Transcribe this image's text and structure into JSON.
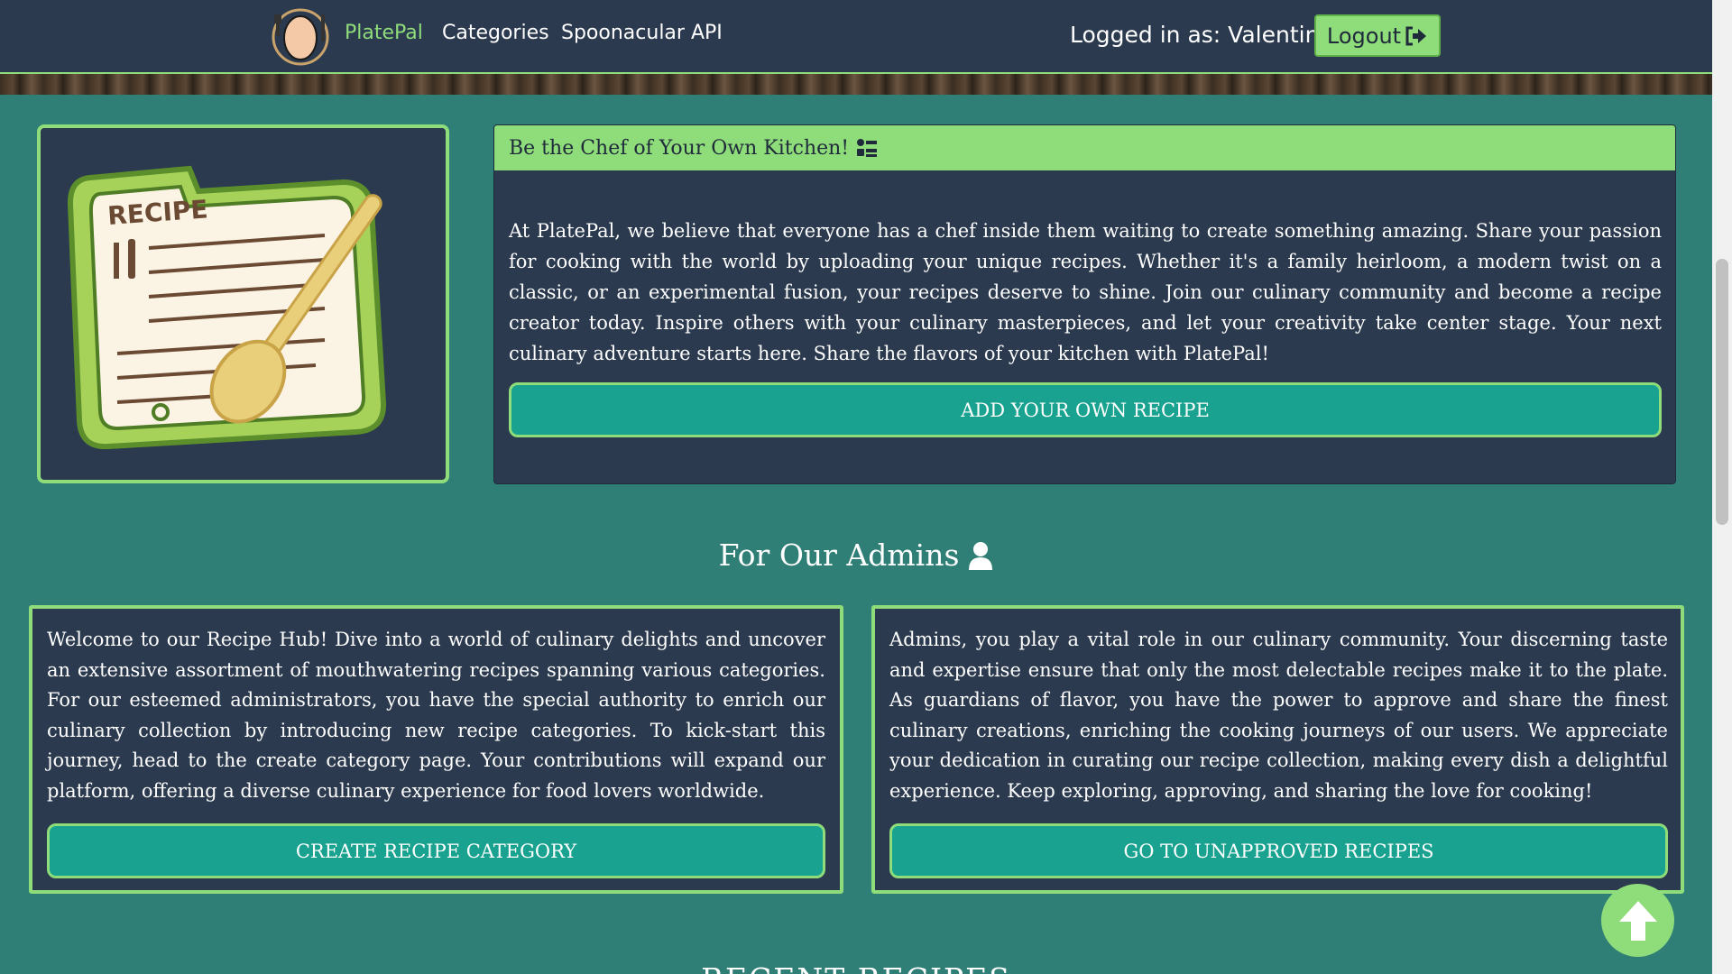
{
  "navbar": {
    "brand": "PlatePal",
    "links": [
      "Categories",
      "Spoonacular API"
    ],
    "logged_in": "Logged in as: Valentin",
    "logout_label": "Logout"
  },
  "chef_card": {
    "title": "Be the Chef of Your Own Kitchen!",
    "text": "At PlatePal, we believe that everyone has a chef inside them waiting to create something amazing. Share your passion for cooking with the world by uploading your unique recipes. Whether it's a family heirloom, a modern twist on a classic, or an experimental fusion, your recipes deserve to shine. Join our culinary community and become a recipe creator today. Inspire others with your culinary masterpieces, and let your creativity take center stage. Your next culinary adventure starts here. Share the flavors of your kitchen with PlatePal!",
    "button": "ADD YOUR OWN RECIPE"
  },
  "recipe_image": {
    "label": "RECIPE"
  },
  "admins": {
    "title": "For Our Admins",
    "left_text": "Welcome to our Recipe Hub! Dive into a world of culinary delights and uncover an extensive assortment of mouthwatering recipes spanning various categories. For our esteemed administrators, you have the special authority to enrich our culinary collection by introducing new recipe categories. To kick-start this journey, head to the create category page. Your contributions will expand our platform, offering a diverse culinary experience for food lovers worldwide.",
    "left_button": "CREATE RECIPE CATEGORY",
    "right_text": "Admins, you play a vital role in our culinary community. Your discerning taste and expertise ensure that only the most delectable recipes make it to the plate. As guardians of flavor, you have the power to approve and share the finest culinary creations, enriching the cooking journeys of our users. We appreciate your dedication in curating our recipe collection, making every dish a delightful experience. Keep exploring, approving, and sharing the love for cooking!",
    "right_button": "GO TO UNAPPROVED RECIPES"
  },
  "recent_heading": "RECENT RECIPES",
  "colors": {
    "background": "#2f7f77",
    "navbar": "#2b3a4e",
    "accent_green": "#8fdc7a",
    "button_teal": "#18a28f"
  }
}
